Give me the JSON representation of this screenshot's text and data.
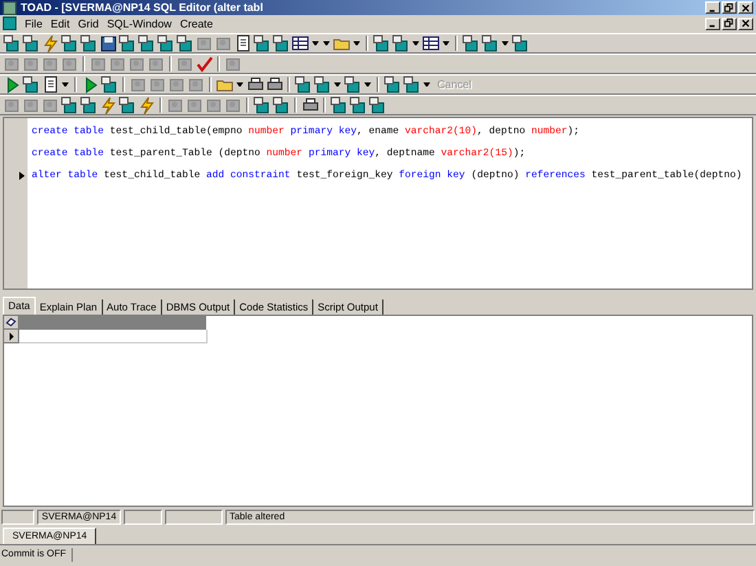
{
  "window": {
    "title": "TOAD - [SVERMA@NP14 SQL Editor (alter tabl"
  },
  "menu": [
    "File",
    "Edit",
    "Grid",
    "SQL-Window",
    "Create"
  ],
  "toolbar": {
    "cancel": {
      "label": "Cancel",
      "disabled": true
    }
  },
  "editor": {
    "lines": [
      {
        "current": false,
        "tokens": [
          {
            "kind": "keyword",
            "text": "create table"
          },
          {
            "kind": "text",
            "text": " test_child_table(empno "
          },
          {
            "kind": "type",
            "text": "number"
          },
          {
            "kind": "keyword",
            "text": " primary key"
          },
          {
            "kind": "text",
            "text": ", ename "
          },
          {
            "kind": "type",
            "text": "varchar2(10)"
          },
          {
            "kind": "text",
            "text": ", deptno "
          },
          {
            "kind": "type",
            "text": "number"
          },
          {
            "kind": "text",
            "text": ");"
          }
        ]
      },
      {
        "current": false,
        "tokens": [
          {
            "kind": "keyword",
            "text": "create table"
          },
          {
            "kind": "text",
            "text": " test_parent_Table (deptno "
          },
          {
            "kind": "type",
            "text": "number"
          },
          {
            "kind": "keyword",
            "text": " primary key"
          },
          {
            "kind": "text",
            "text": ", deptname "
          },
          {
            "kind": "type",
            "text": "varchar2(15)"
          },
          {
            "kind": "text",
            "text": ");"
          }
        ]
      },
      {
        "current": true,
        "tokens": [
          {
            "kind": "keyword",
            "text": "alter table"
          },
          {
            "kind": "text",
            "text": " test_child_table "
          },
          {
            "kind": "keyword",
            "text": "add constraint"
          },
          {
            "kind": "text",
            "text": " test_foreign_key "
          },
          {
            "kind": "keyword",
            "text": "foreign key"
          },
          {
            "kind": "text",
            "text": " (deptno) "
          },
          {
            "kind": "keyword",
            "text": "references"
          },
          {
            "kind": "text",
            "text": " test_parent_table(deptno)"
          }
        ]
      }
    ]
  },
  "tabs": [
    {
      "label": "Data",
      "selected": true
    },
    {
      "label": "Explain Plan",
      "selected": false
    },
    {
      "label": "Auto Trace",
      "selected": false
    },
    {
      "label": "DBMS Output",
      "selected": false
    },
    {
      "label": "Code Statistics",
      "selected": false
    },
    {
      "label": "Script Output",
      "selected": false
    }
  ],
  "status_bar": {
    "user": "SVERMA@NP14",
    "message": "Table altered"
  },
  "connections": [
    {
      "label": "SVERMA@NP14",
      "selected": true
    }
  ],
  "commit_status": "Commit is OFF"
}
